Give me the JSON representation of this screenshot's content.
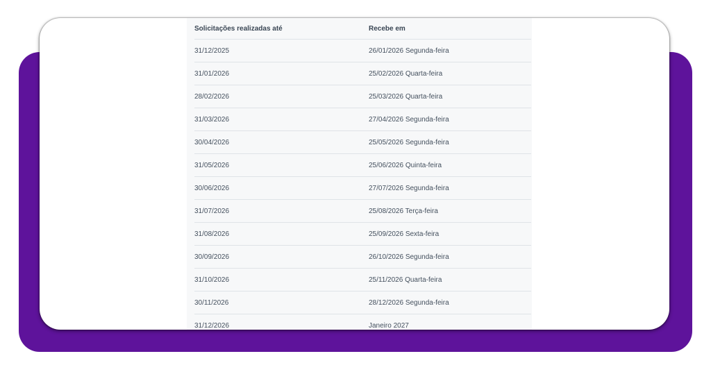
{
  "table": {
    "headers": [
      "Solicitações realizadas até",
      "Recebe em"
    ],
    "rows": [
      [
        "31/12/2025",
        "26/01/2026 Segunda-feira"
      ],
      [
        "31/01/2026",
        "25/02/2026 Quarta-feira"
      ],
      [
        "28/02/2026",
        "25/03/2026 Quarta-feira"
      ],
      [
        "31/03/2026",
        "27/04/2026 Segunda-feira"
      ],
      [
        "30/04/2026",
        "25/05/2026 Segunda-feira"
      ],
      [
        "31/05/2026",
        "25/06/2026 Quinta-feira"
      ],
      [
        "30/06/2026",
        "27/07/2026 Segunda-feira"
      ],
      [
        "31/07/2026",
        "25/08/2026 Terça-feira"
      ],
      [
        "31/08/2026",
        "25/09/2026 Sexta-feira"
      ],
      [
        "30/09/2026",
        "26/10/2026 Segunda-feira"
      ],
      [
        "31/10/2026",
        "25/11/2026 Quarta-feira"
      ],
      [
        "30/11/2026",
        "28/12/2026 Segunda-feira"
      ],
      [
        "31/12/2026",
        "Janeiro 2027"
      ]
    ]
  },
  "colors": {
    "backdrop": "#5e139b",
    "card": "#ffffff",
    "panel": "#f7f8f9",
    "text": "#44505e",
    "divider": "#dfe3e7"
  }
}
